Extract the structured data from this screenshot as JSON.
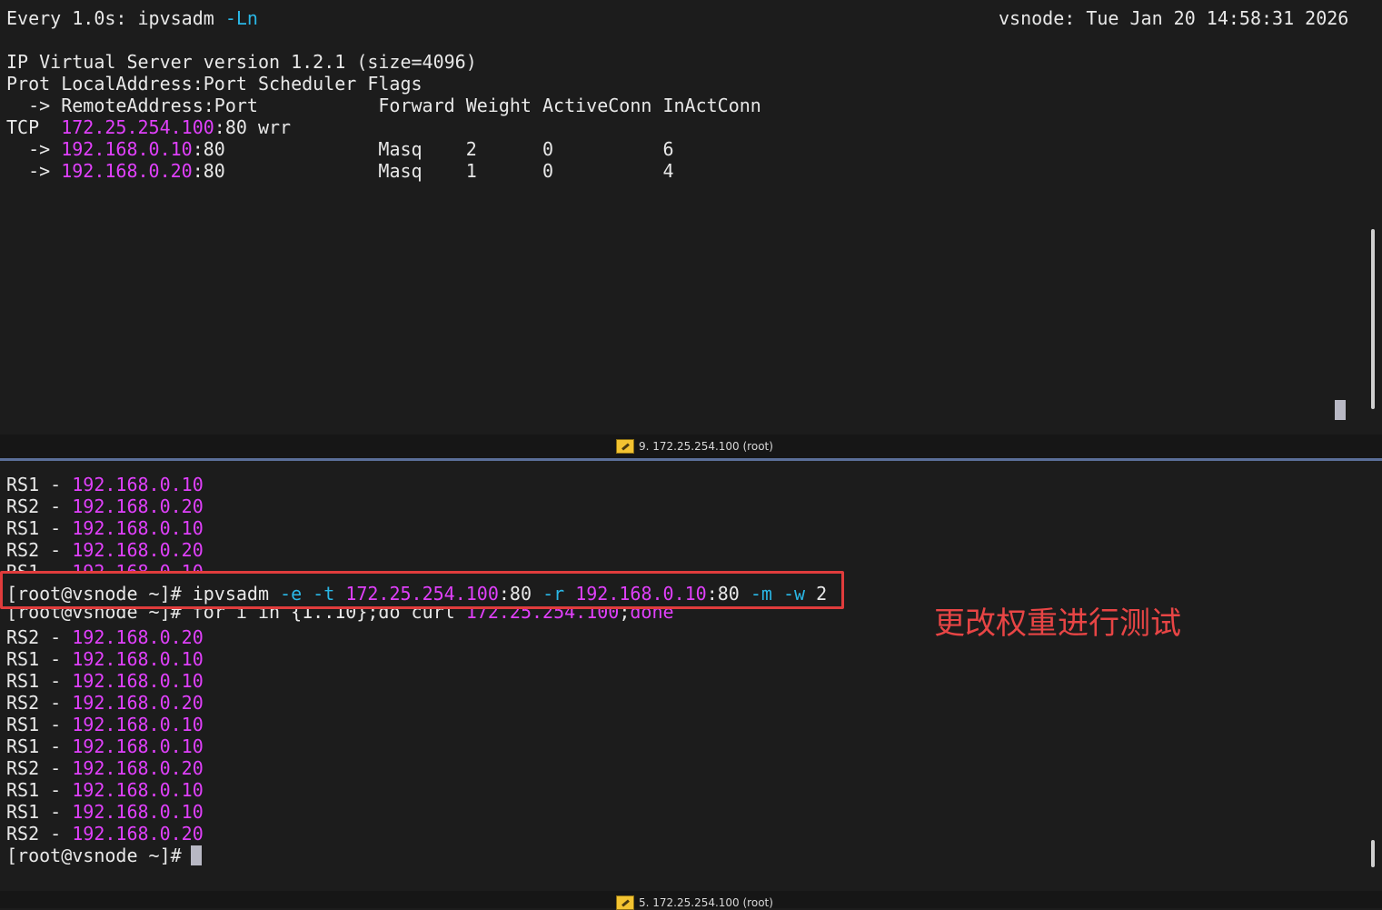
{
  "top_pane": {
    "header_left_prefix": "Every 1.0s: ipvsadm ",
    "header_left_flag": "-Ln",
    "header_right": "vsnode: Tue Jan 20 14:58:31 2026",
    "version_line": "IP Virtual Server version 1.2.1 (size=4096)",
    "header_row1": "Prot LocalAddress:Port Scheduler Flags",
    "header_row2": "  -> RemoteAddress:Port           Forward Weight ActiveConn InActConn",
    "service": {
      "prefix": "TCP  ",
      "ip": "172.25.254.100",
      "suffix": ":80 wrr"
    },
    "real_servers": [
      {
        "prefix": "  -> ",
        "ip": "192.168.0.10",
        "suffix": ":80              Masq    2      0          6"
      },
      {
        "prefix": "  -> ",
        "ip": "192.168.0.20",
        "suffix": ":80              Masq    1      0          4"
      }
    ]
  },
  "titlebar_top": {
    "label": "9. 172.25.254.100 (root)"
  },
  "bottom_pane": {
    "pre_lines": [
      {
        "rs": "RS1 - ",
        "ip": "192.168.0.10"
      },
      {
        "rs": "RS2 - ",
        "ip": "192.168.0.20"
      },
      {
        "rs": "RS1 - ",
        "ip": "192.168.0.10"
      },
      {
        "rs": "RS2 - ",
        "ip": "192.168.0.20"
      },
      {
        "rs": "RS1 - ",
        "ip": "192.168.0.10"
      }
    ],
    "edit_cmd": {
      "prompt": "[root@vsnode ~]# ",
      "cmd": "ipvsadm ",
      "opt_e": "-e",
      "sp1": " ",
      "opt_t": "-t",
      "sp2": " ",
      "vip": "172.25.254.100",
      "port1": ":80 ",
      "opt_r": "-r",
      "sp3": " ",
      "rip": "192.168.0.10",
      "port2": ":80 ",
      "opt_m": "-m",
      "sp4": " ",
      "opt_w": "-w",
      "weight": " 2"
    },
    "loop_cmd": {
      "prompt": "[root@vsnode ~]# ",
      "cmd": "for i in {1..10};do curl ",
      "vip": "172.25.254.100",
      "semi": ";",
      "done": "done"
    },
    "results": [
      {
        "rs": "RS2 - ",
        "ip": "192.168.0.20"
      },
      {
        "rs": "RS1 - ",
        "ip": "192.168.0.10"
      },
      {
        "rs": "RS1 - ",
        "ip": "192.168.0.10"
      },
      {
        "rs": "RS2 - ",
        "ip": "192.168.0.20"
      },
      {
        "rs": "RS1 - ",
        "ip": "192.168.0.10"
      },
      {
        "rs": "RS1 - ",
        "ip": "192.168.0.10"
      },
      {
        "rs": "RS2 - ",
        "ip": "192.168.0.20"
      },
      {
        "rs": "RS1 - ",
        "ip": "192.168.0.10"
      },
      {
        "rs": "RS1 - ",
        "ip": "192.168.0.10"
      },
      {
        "rs": "RS2 - ",
        "ip": "192.168.0.20"
      }
    ],
    "final_prompt": "[root@vsnode ~]# "
  },
  "annotation": {
    "text": "更改权重进行测试",
    "color": "#e84545"
  },
  "titlebar_bottom": {
    "label": "5. 172.25.254.100 (root)"
  },
  "colors": {
    "background": "#1c1c1c",
    "text": "#e8e8e8",
    "ip_magenta": "#e040fb",
    "option_cyan": "#2ab7e6",
    "highlight_red": "#e03c3c"
  }
}
